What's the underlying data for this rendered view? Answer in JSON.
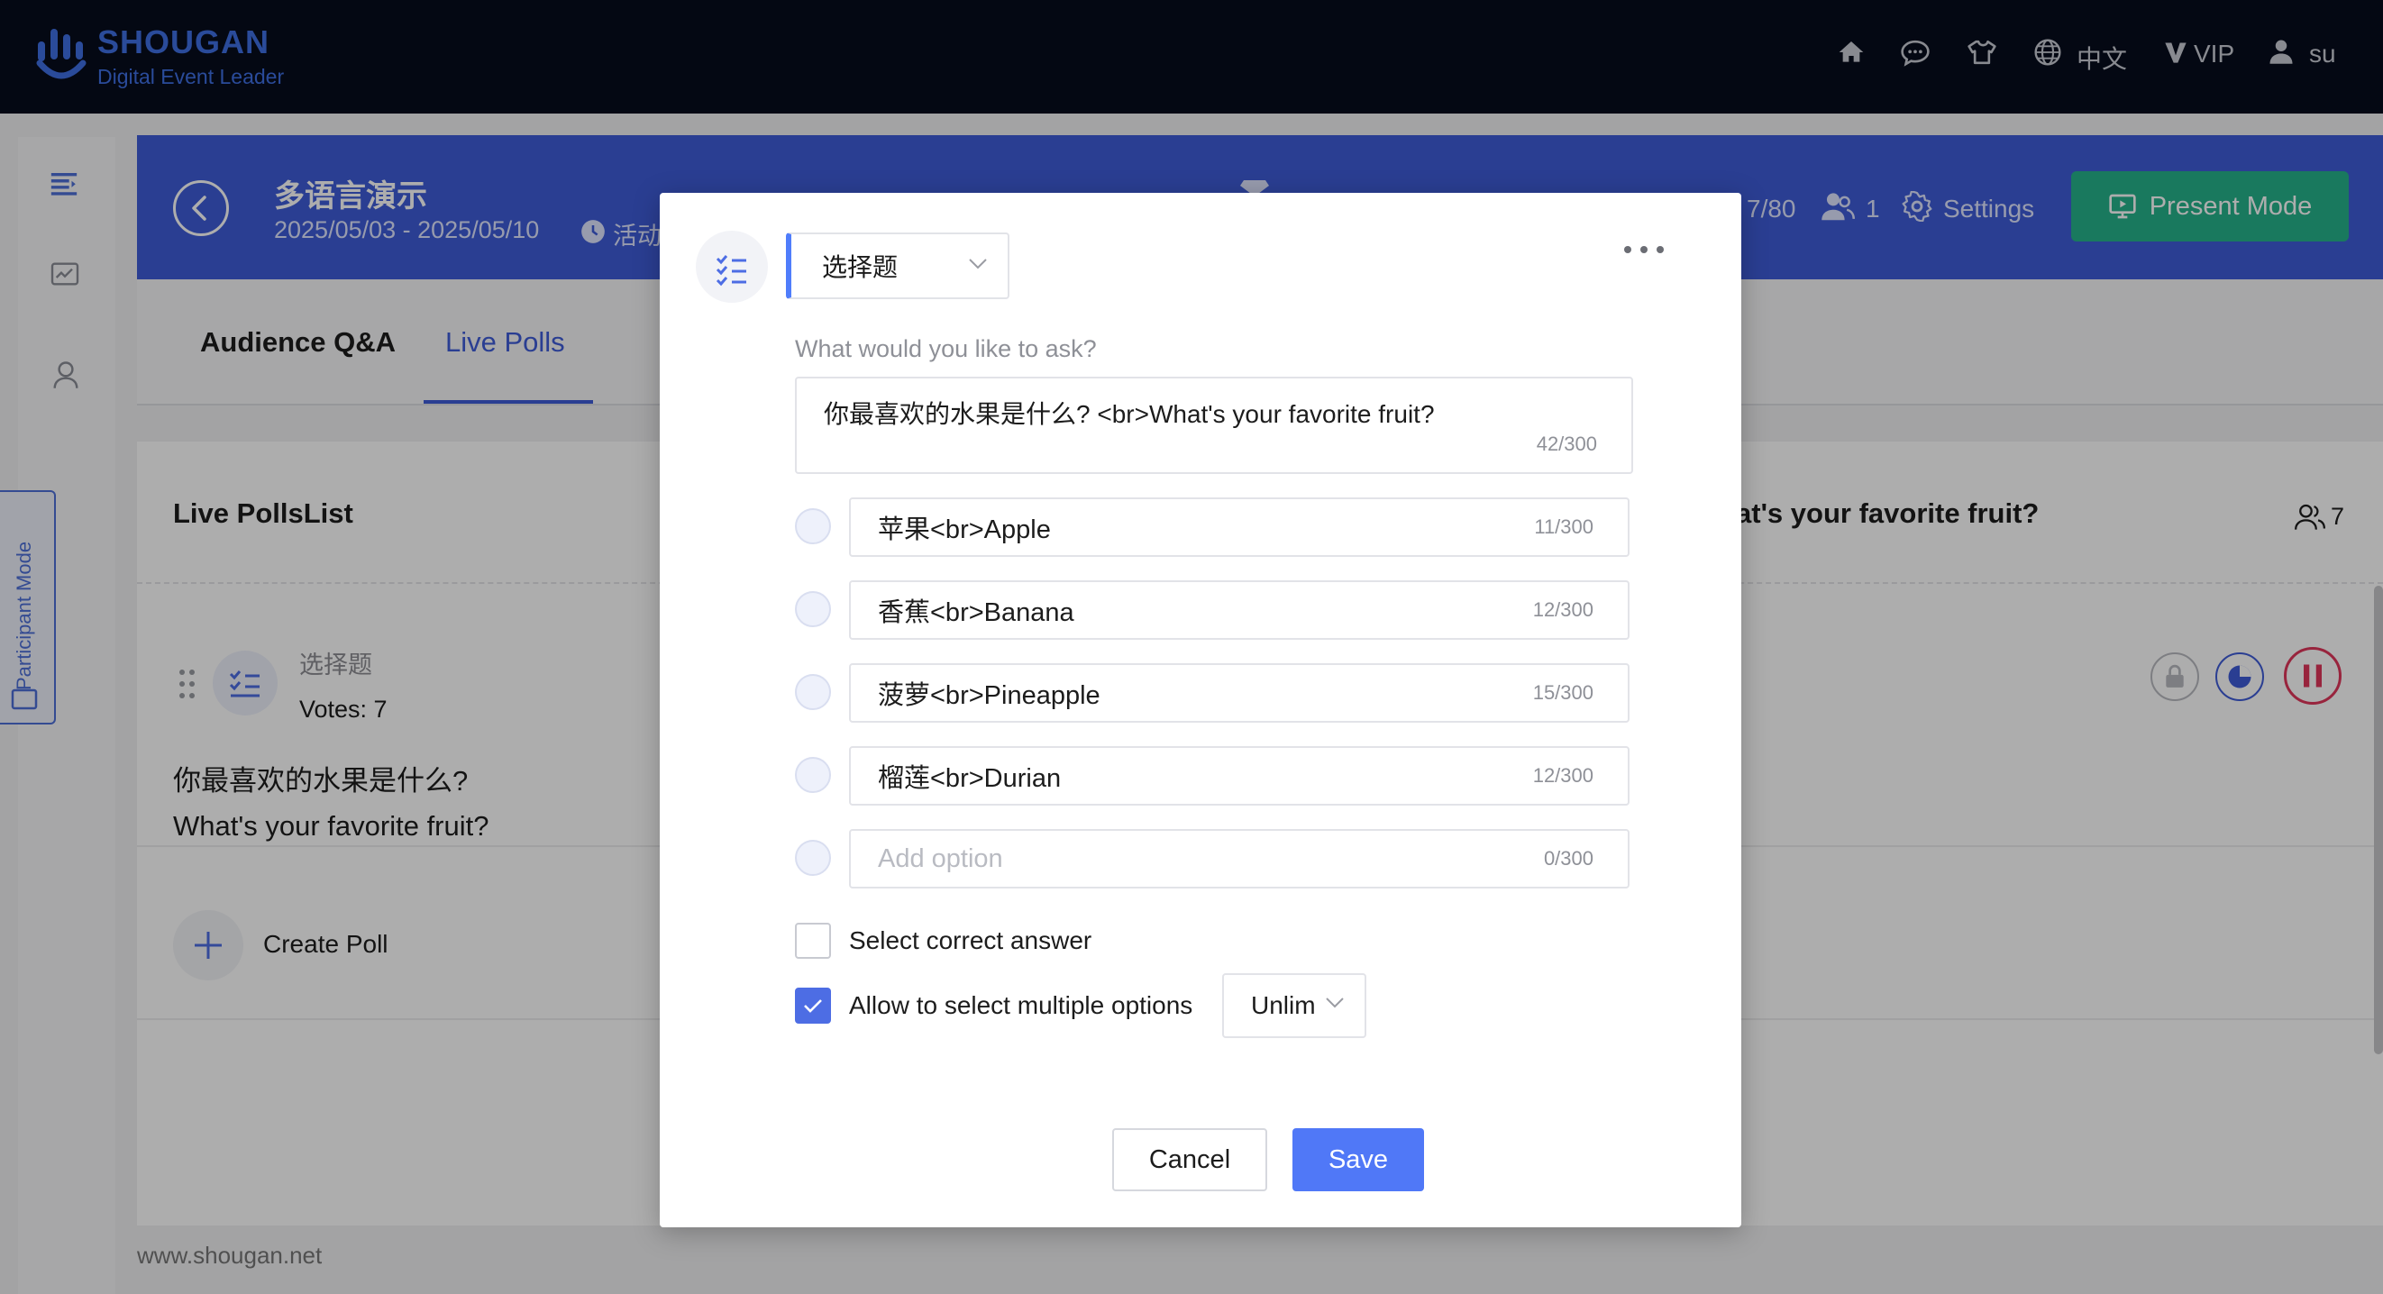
{
  "brand": {
    "name": "SHOUGAN",
    "tagline": "Digital Event Leader"
  },
  "topnav": {
    "language": "中文",
    "vip": "VIP",
    "user": "su"
  },
  "sidebar": {
    "participant_mode": "Participant Mode"
  },
  "event": {
    "title": "多语言演示",
    "dates": "2025/05/03 - 2025/05/10",
    "status": "活动",
    "capacity": "7/80",
    "online": "1",
    "settings_label": "Settings",
    "present_label": "Present Mode"
  },
  "tabs": [
    {
      "label": "Audience Q&A"
    },
    {
      "label": "Live Polls"
    }
  ],
  "list": {
    "title": "Live PollsList",
    "poll": {
      "type": "选择题",
      "votes": "Votes: 7",
      "question_line1": "你最喜欢的水果是什么?",
      "question_line2": "What's your favorite fruit?"
    },
    "create_label": "Create Poll",
    "right_title": "at's your favorite fruit?",
    "right_count": "7"
  },
  "footer": {
    "site": "www.shougan.net"
  },
  "modal": {
    "type_selected": "选择题",
    "question_label": "What would you like to ask?",
    "question_value": "你最喜欢的水果是什么? <br>What's your favorite fruit?",
    "question_count": "42/300",
    "options": [
      {
        "value": "苹果<br>Apple",
        "count": "11/300"
      },
      {
        "value": "香蕉<br>Banana",
        "count": "12/300"
      },
      {
        "value": "菠萝<br>Pineapple",
        "count": "15/300"
      },
      {
        "value": "榴莲<br>Durian",
        "count": "12/300"
      }
    ],
    "add_option_placeholder": "Add option",
    "add_option_count": "0/300",
    "correct_answer_label": "Select correct answer",
    "multiple_label": "Allow to select multiple options",
    "limit_value": "Unlim",
    "cancel_label": "Cancel",
    "save_label": "Save"
  },
  "colors": {
    "primary": "#3f5cd8",
    "accent": "#5078f7",
    "present": "#26b38b",
    "topbar": "#070d1d",
    "danger": "#e0355a"
  }
}
